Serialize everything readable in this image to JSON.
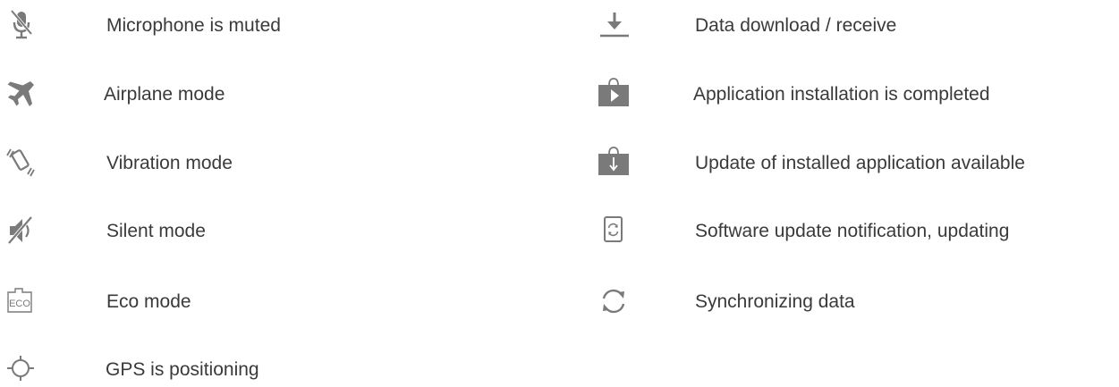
{
  "left_items": [
    {
      "icon": "microphone-muted-icon",
      "label": "Microphone is muted"
    },
    {
      "icon": "airplane-icon",
      "label": "Airplane mode"
    },
    {
      "icon": "vibration-icon",
      "label": "Vibration mode"
    },
    {
      "icon": "silent-mode-icon",
      "label": "Silent mode"
    },
    {
      "icon": "eco-icon",
      "label": "Eco mode"
    },
    {
      "icon": "gps-icon",
      "label": "GPS is positioning"
    }
  ],
  "right_items": [
    {
      "icon": "download-icon",
      "label": "Data download / receive"
    },
    {
      "icon": "play-store-install-icon",
      "label": "Application installation is completed"
    },
    {
      "icon": "store-update-icon",
      "label": "Update of installed application available"
    },
    {
      "icon": "software-update-icon",
      "label": "Software update notification, updating"
    },
    {
      "icon": "sync-icon",
      "label": "Synchronizing data"
    }
  ],
  "icons": {
    "eco_text": "ECO"
  },
  "colors": {
    "icon": "#7a7a7a",
    "text": "#3a3a3a"
  }
}
